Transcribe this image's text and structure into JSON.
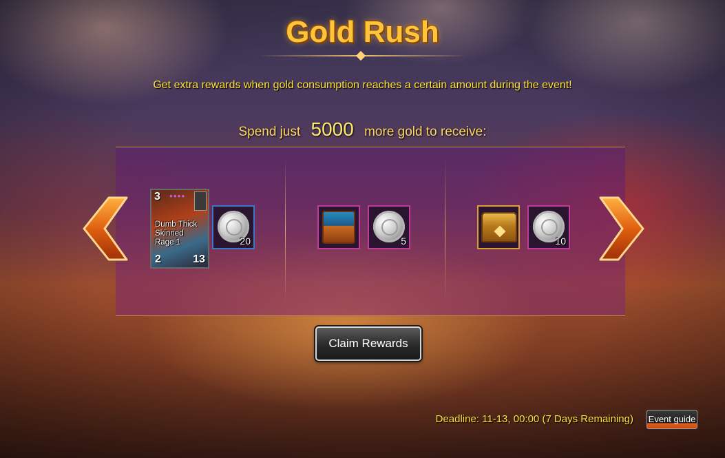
{
  "event": {
    "title": "Gold Rush",
    "description": "Get extra rewards when gold consumption reaches a certain amount during the event!",
    "spend_prefix": "Spend just",
    "spend_amount": "5000",
    "spend_suffix": "more gold to receive:"
  },
  "rewards": {
    "group1": {
      "card": {
        "cost": "3",
        "name": "Dumb Thick Skinned Rage 1",
        "attack": "2",
        "health": "13",
        "rarity_dots": "●●●●"
      },
      "coin_qty": "20"
    },
    "group2": {
      "item_icon": "blue-chest-icon",
      "coin_qty": "5"
    },
    "group3": {
      "item_icon": "gold-chest-icon",
      "coin_qty": "10"
    }
  },
  "buttons": {
    "claim_label": "Claim Rewards",
    "guide_label": "Event guide"
  },
  "footer": {
    "deadline": "Deadline: 11-13, 00:00 (7 Days Remaining)"
  },
  "colors": {
    "title_gold": "#ffc53a",
    "text_yellow": "#ffe23a",
    "slot_pink": "#c23a9a",
    "slot_blue": "#3a78c8",
    "slot_gold": "#d9a030"
  }
}
